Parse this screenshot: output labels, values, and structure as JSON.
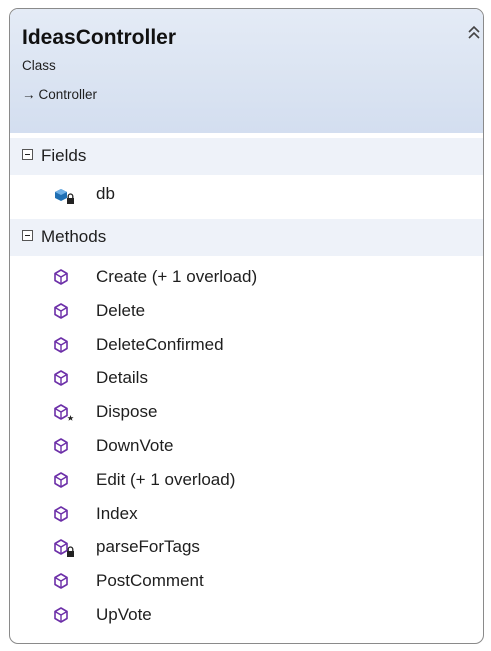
{
  "class": {
    "name": "IdeasController",
    "kind": "Class",
    "base_arrow": "→",
    "base": "Controller"
  },
  "fields": {
    "label": "Fields",
    "items": [
      {
        "name": "db",
        "icon": "private-field-icon"
      }
    ]
  },
  "methods": {
    "label": "Methods",
    "items": [
      {
        "name": "Create (+ 1 overload)",
        "icon": "method-icon"
      },
      {
        "name": "Delete",
        "icon": "method-icon"
      },
      {
        "name": "DeleteConfirmed",
        "icon": "method-icon"
      },
      {
        "name": "Details",
        "icon": "method-icon"
      },
      {
        "name": "Dispose",
        "icon": "protected-method-icon"
      },
      {
        "name": "DownVote",
        "icon": "method-icon"
      },
      {
        "name": "Edit (+ 1 overload)",
        "icon": "method-icon"
      },
      {
        "name": "Index",
        "icon": "method-icon"
      },
      {
        "name": "parseForTags",
        "icon": "private-method-icon"
      },
      {
        "name": "PostComment",
        "icon": "method-icon"
      },
      {
        "name": "UpVote",
        "icon": "method-icon"
      }
    ]
  },
  "colors": {
    "method_icon": "#6c2fa8",
    "field_icon": "#1f6fb3",
    "header_bg": "#dbe4f2",
    "section_bg": "#eef2f9"
  }
}
